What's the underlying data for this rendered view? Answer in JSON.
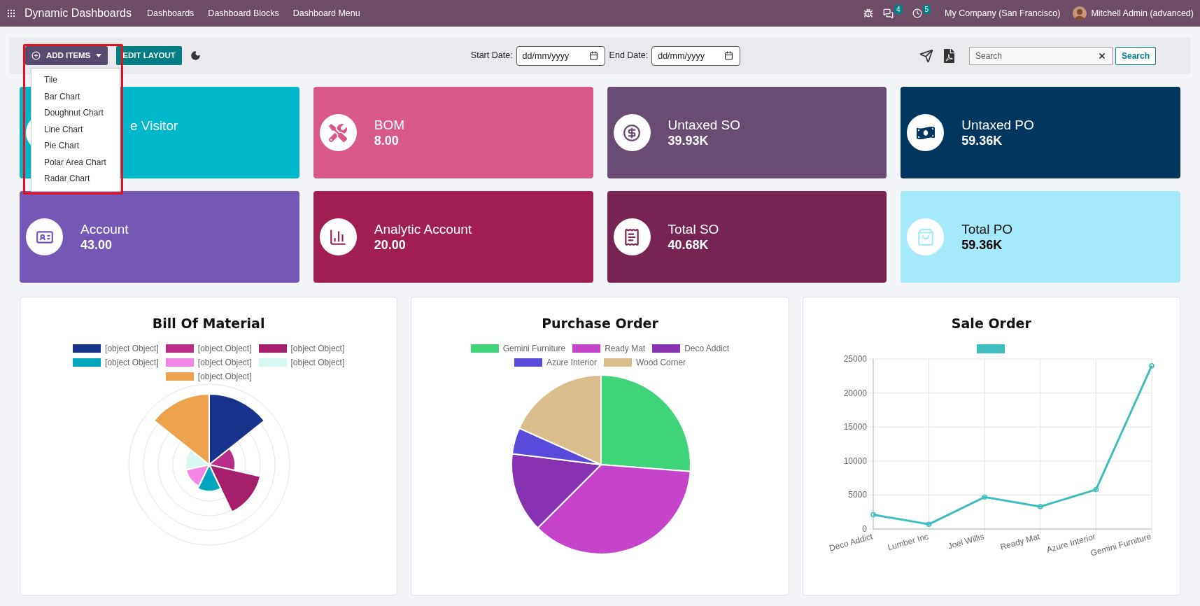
{
  "navbar": {
    "app_title": "Dynamic Dashboards",
    "menu": [
      "Dashboards",
      "Dashboard Blocks",
      "Dashboard Menu"
    ],
    "chat_count": "4",
    "activity_count": "5",
    "company": "My Company (San Francisco)",
    "user": "Mitchell Admin (advanced)"
  },
  "toolbar": {
    "add_items": "ADD ITEMS",
    "edit_layout": "EDIT LAYOUT",
    "start_date": {
      "label": "Start Date:",
      "placeholder": "dd/mm/yyyy"
    },
    "end_date": {
      "label": "End Date:",
      "placeholder": "dd/mm/yyyy"
    },
    "search": {
      "placeholder": "Search"
    },
    "search_button": "Search"
  },
  "add_menu": {
    "items": [
      "Tile",
      "Bar Chart",
      "Doughnut Chart",
      "Line Chart",
      "Pie Chart",
      "Polar Area Chart",
      "Radar Chart"
    ]
  },
  "tiles": [
    {
      "title": "e Visitor",
      "color": "#00b7cc"
    },
    {
      "title": "BOM",
      "value": "8.00",
      "color": "#d8588a"
    },
    {
      "title": "Untaxed SO",
      "value": "39.93K",
      "color": "#694c72"
    },
    {
      "title": "Untaxed PO",
      "value": "59.36K",
      "color": "#013660"
    },
    {
      "title": "Account",
      "value": "43.00",
      "color": "#7557b5"
    },
    {
      "title": "Analytic Account",
      "value": "20.00",
      "color": "#a01e52"
    },
    {
      "title": "Total SO",
      "value": "40.68K",
      "color": "#782453"
    },
    {
      "title": "Total PO",
      "value": "59.36K",
      "color": "#a5eafc"
    }
  ],
  "charts": [
    {
      "title": "Bill Of Material",
      "kind": "polar",
      "legend": [
        {
          "label": "[object Object]",
          "color": "#17328a"
        },
        {
          "label": "[object Object]",
          "color": "#b92d87"
        },
        {
          "label": "[object Object]",
          "color": "#a61f6b"
        },
        {
          "label": "[object Object]",
          "color": "#00a6c0"
        },
        {
          "label": "[object Object]",
          "color": "#f285e6"
        },
        {
          "label": "[object Object]",
          "color": "#d8f7f3"
        },
        {
          "label": "[object Object]",
          "color": "#eda34e"
        }
      ]
    },
    {
      "title": "Purchase Order",
      "kind": "pie",
      "legend": [
        {
          "label": "Gemini Furniture",
          "color": "#3fd37a"
        },
        {
          "label": "Ready Mat",
          "color": "#c544c9"
        },
        {
          "label": "Deco Addict",
          "color": "#8631b0"
        },
        {
          "label": "Azure Interior",
          "color": "#5a4ad9"
        },
        {
          "label": "Wood Corner",
          "color": "#d9be8c"
        }
      ]
    },
    {
      "title": "Sale Order",
      "kind": "line",
      "chart_data": {
        "type": "line",
        "categories": [
          "Deco Addict",
          "Lumber Inc",
          "Joel Willis",
          "Ready Mat",
          "Azure Interior",
          "Gemini Furniture"
        ],
        "series": [
          {
            "color": "#3fbdbd",
            "marker": "circle",
            "values": [
              2100,
              700,
              4700,
              3300,
              5800,
              24000
            ]
          }
        ],
        "grid": true,
        "ylim": [
          0,
          25000
        ],
        "yticks": [
          0,
          5000,
          10000,
          15000,
          20000,
          25000
        ]
      }
    }
  ]
}
